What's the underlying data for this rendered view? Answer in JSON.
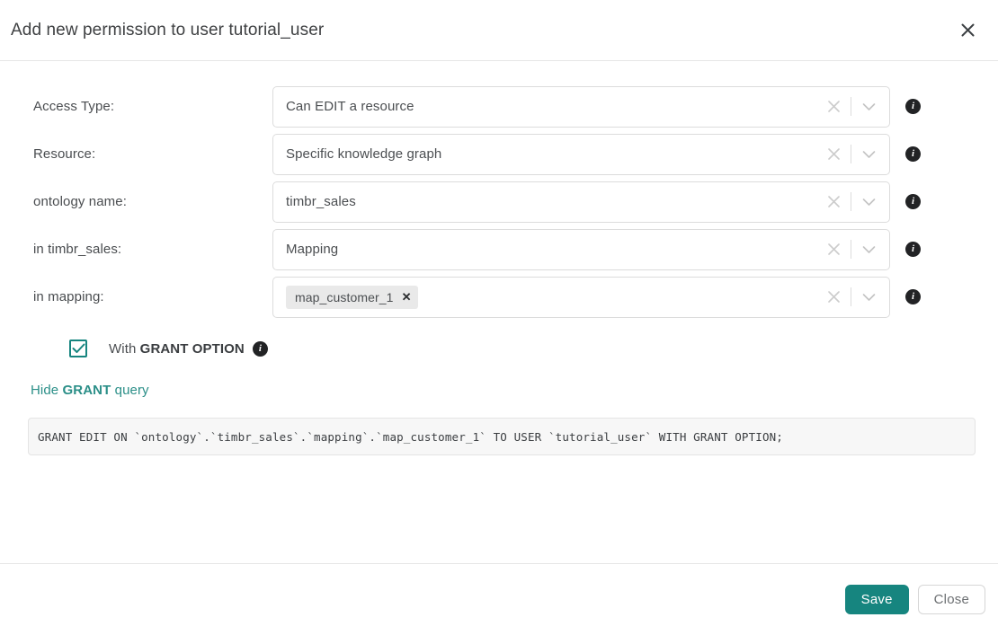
{
  "header": {
    "title": "Add new permission to user tutorial_user",
    "close_icon": "close-icon"
  },
  "form": {
    "rows": [
      {
        "label": "Access Type:",
        "value": "Can EDIT a resource",
        "type": "select",
        "clear_icon": "clear-x-icon",
        "dropdown_icon": "chevron-down-icon",
        "info_icon": "info-icon",
        "info_glyph": "i"
      },
      {
        "label": "Resource:",
        "value": "Specific knowledge graph",
        "type": "select",
        "clear_icon": "clear-x-icon",
        "dropdown_icon": "chevron-down-icon",
        "info_icon": "info-icon",
        "info_glyph": "i"
      },
      {
        "label": "ontology name:",
        "value": "timbr_sales",
        "type": "select",
        "clear_icon": "clear-x-icon",
        "dropdown_icon": "chevron-down-icon",
        "info_icon": "info-icon",
        "info_glyph": "i"
      },
      {
        "label": "in timbr_sales:",
        "value": "Mapping",
        "type": "select",
        "clear_icon": "clear-x-icon",
        "dropdown_icon": "chevron-down-icon",
        "info_icon": "info-icon",
        "info_glyph": "i"
      },
      {
        "label": "in mapping:",
        "value": "",
        "type": "multiselect",
        "chip_label": "map_customer_1",
        "chip_remove": "✕",
        "clear_icon": "clear-x-icon",
        "dropdown_icon": "chevron-down-icon",
        "info_icon": "info-icon",
        "info_glyph": "i"
      }
    ]
  },
  "grant_option": {
    "checked": true,
    "prefix": "With ",
    "strong": "GRANT OPTION",
    "info_glyph": "i"
  },
  "query_toggle": {
    "prefix": "Hide ",
    "strong": "GRANT",
    "suffix": " query"
  },
  "sql": {
    "query": "GRANT EDIT ON `ontology`.`timbr_sales`.`mapping`.`map_customer_1` TO USER `tutorial_user` WITH GRANT OPTION;"
  },
  "footer": {
    "save_label": "Save",
    "close_label": "Close"
  },
  "colors": {
    "accent": "#16857f",
    "link": "#2b8f88",
    "text": "#4a4d50",
    "border": "#dcdcdc",
    "code_bg": "#f7f7f7",
    "chip_bg": "#e9e9e9"
  }
}
